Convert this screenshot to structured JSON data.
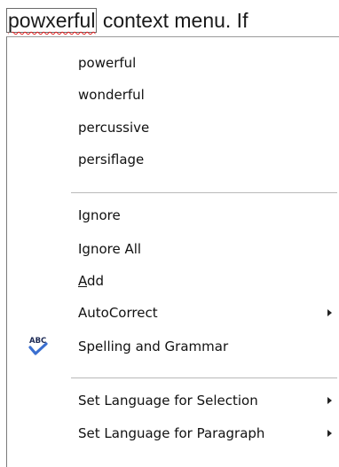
{
  "document": {
    "misspelled_word": "powxerful",
    "rest_text": " context menu. If"
  },
  "menu": {
    "suggestions": [
      "powerful",
      "wonderful",
      "percussive",
      "persiflage"
    ],
    "ignore": "Ignore",
    "ignore_all": "Ignore All",
    "add_accel": "A",
    "add_rest": "dd",
    "autocorrect": "AutoCorrect",
    "spelling_grammar": "Spelling and Grammar",
    "spelling_icon_text": "ABC",
    "set_language_selection": "Set Language for Selection",
    "set_language_paragraph": "Set Language for Paragraph"
  },
  "icons": {
    "spelling": "spell-check-icon",
    "submenu": "submenu-arrow-icon"
  },
  "colors": {
    "squiggle": "#e02020",
    "check": "#3a6fd0"
  }
}
